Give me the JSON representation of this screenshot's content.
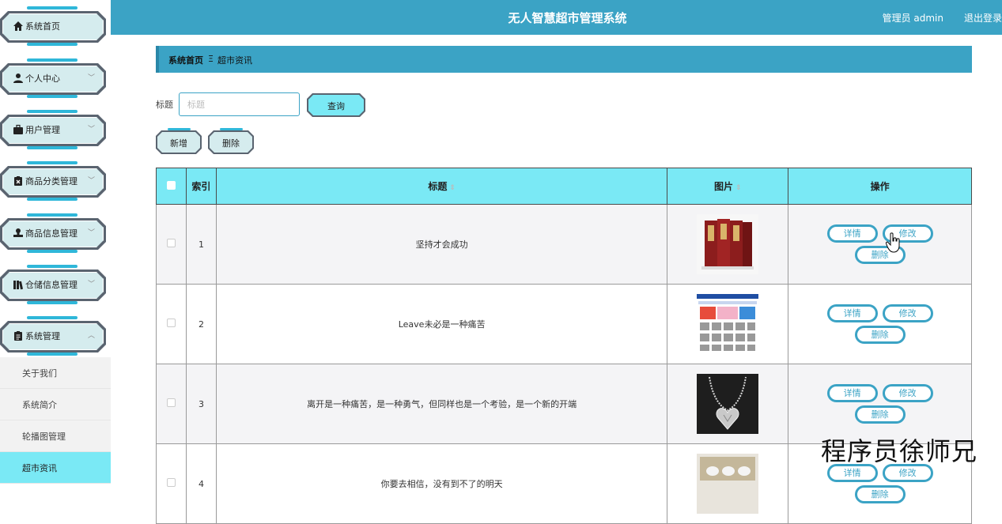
{
  "app": {
    "title": "无人智慧超市管理系统",
    "user_label": "管理员 admin",
    "logout_label": "退出登录"
  },
  "sidebar": {
    "items": [
      {
        "label": "系统首页",
        "icon": "home-icon",
        "chevron": ""
      },
      {
        "label": "个人中心",
        "icon": "person-icon",
        "chevron": "﹀"
      },
      {
        "label": "用户管理",
        "icon": "briefcase-icon",
        "chevron": "﹀"
      },
      {
        "label": "商品分类管理",
        "icon": "clipboard-x-icon",
        "chevron": "﹀"
      },
      {
        "label": "商品信息管理",
        "icon": "stamp-icon",
        "chevron": "﹀"
      },
      {
        "label": "仓储信息管理",
        "icon": "books-icon",
        "chevron": "﹀"
      },
      {
        "label": "系统管理",
        "icon": "clipboard-icon",
        "chevron": "︿"
      }
    ],
    "sub_items": [
      {
        "label": "关于我们"
      },
      {
        "label": "系统简介"
      },
      {
        "label": "轮播图管理"
      },
      {
        "label": "超市资讯"
      }
    ]
  },
  "breadcrumb": {
    "home": "系统首页",
    "separator": "Ξ",
    "current": "超市资讯"
  },
  "search": {
    "label": "标题",
    "placeholder": "标题",
    "value": "",
    "button": "查询"
  },
  "actions": {
    "add": "新增",
    "delete": "删除"
  },
  "table": {
    "columns": [
      "索引",
      "标题",
      "图片",
      "操作"
    ],
    "rows": [
      {
        "index": "1",
        "title": "坚持才会成功",
        "image": "book-set-image"
      },
      {
        "index": "2",
        "title": "Leave未必是一种痛苦",
        "image": "webpage-screenshot-image"
      },
      {
        "index": "3",
        "title": "离开是一种痛苦，是一种勇气，但同样也是一个考验，是一个新的开端",
        "image": "heart-necklace-image"
      },
      {
        "index": "4",
        "title": "你要去相信，没有到不了的明天",
        "image": "tea-set-image"
      }
    ],
    "op_labels": {
      "detail": "详情",
      "edit": "修改",
      "delete": "删除"
    }
  },
  "watermark": "程序员徐师兄",
  "colors": {
    "accent": "#3ba3c5",
    "header_cell": "#7ae9f5",
    "menu_face": "#d5ecee"
  }
}
